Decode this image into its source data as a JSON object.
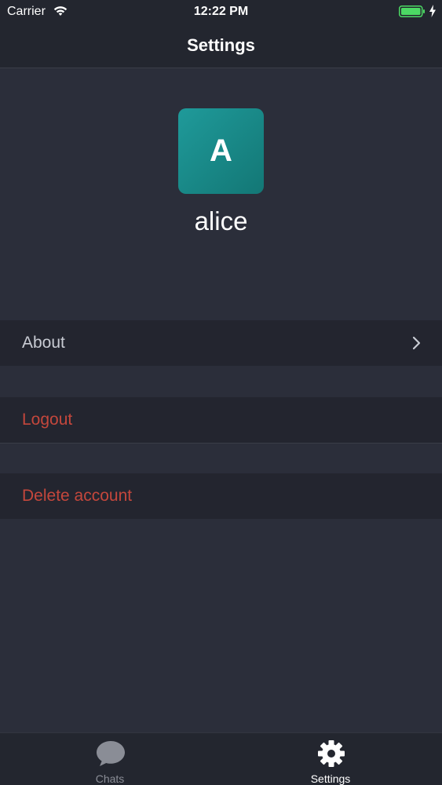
{
  "status_bar": {
    "carrier": "Carrier",
    "time": "12:22 PM",
    "battery_color": "#4cd964"
  },
  "nav": {
    "title": "Settings"
  },
  "profile": {
    "avatar_letter": "A",
    "username": "alice",
    "avatar_color": "#1a8f8e"
  },
  "menu": {
    "about": "About",
    "logout": "Logout",
    "delete_account": "Delete account",
    "destructive_color": "#c4473c"
  },
  "tabs": [
    {
      "label": "Chats",
      "icon": "chat-bubble-icon",
      "active": false
    },
    {
      "label": "Settings",
      "icon": "gear-icon",
      "active": true
    }
  ]
}
